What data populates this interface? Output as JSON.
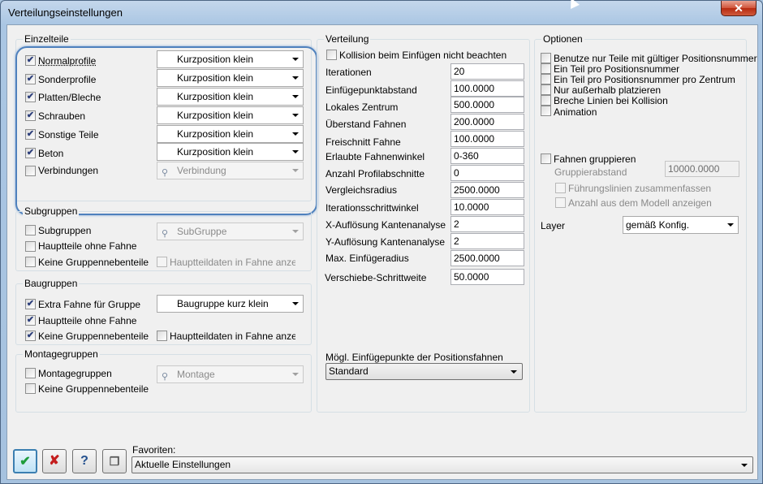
{
  "window": {
    "title": "Verteilungseinstellungen",
    "close": "✕"
  },
  "einzelteile": {
    "title": "Einzelteile",
    "rows": [
      {
        "label": "Normalprofile",
        "checked": true,
        "combo": "Kurzposition klein"
      },
      {
        "label": "Sonderprofile",
        "checked": true,
        "combo": "Kurzposition klein"
      },
      {
        "label": "Platten/Bleche",
        "checked": true,
        "combo": "Kurzposition klein"
      },
      {
        "label": "Schrauben",
        "checked": true,
        "combo": "Kurzposition klein"
      },
      {
        "label": "Sonstige Teile",
        "checked": true,
        "combo": "Kurzposition klein"
      },
      {
        "label": "Beton",
        "checked": true,
        "combo": "Kurzposition klein"
      },
      {
        "label": "Verbindungen",
        "checked": false,
        "combo": "Verbindung"
      }
    ]
  },
  "subgruppen": {
    "title": "Subgruppen",
    "subgruppen": "Subgruppen",
    "subgruppe_combo": "SubGruppe",
    "hauptteile": "Hauptteile ohne Fahne",
    "keine": "Keine Gruppennebenteile",
    "hauptteildaten": "Hauptteildaten in Fahne anzeigen"
  },
  "baugruppen": {
    "title": "Baugruppen",
    "extra": "Extra Fahne für Gruppe",
    "extra_combo": "Baugruppe kurz klein",
    "hauptteile": "Hauptteile ohne Fahne",
    "keine": "Keine Gruppennebenteile",
    "hauptteildaten": "Hauptteildaten in Fahne anzeigen"
  },
  "montagegruppen": {
    "title": "Montagegruppen",
    "montagegruppen": "Montagegruppen",
    "montage_combo": "Montage",
    "keine": "Keine Gruppennebenteile"
  },
  "verteilung": {
    "title": "Verteilung",
    "kollision": "Kollision beim Einfügen nicht beachten",
    "fields": [
      {
        "label": "Iterationen",
        "value": "20"
      },
      {
        "label": "Einfügepunktabstand",
        "value": "100.0000"
      },
      {
        "label": "Lokales Zentrum",
        "value": "500.0000"
      },
      {
        "label": "Überstand Fahnen",
        "value": "200.0000"
      },
      {
        "label": "Freischnitt Fahne",
        "value": "100.0000"
      },
      {
        "label": "Erlaubte Fahnenwinkel",
        "value": "0-360"
      },
      {
        "label": "Anzahl Profilabschnitte",
        "value": "0"
      },
      {
        "label": "Vergleichsradius",
        "value": "2500.0000"
      },
      {
        "label": "Iterationsschrittwinkel",
        "value": "10.0000"
      },
      {
        "label": "X-Auflösung Kantenanalyse",
        "value": "2"
      },
      {
        "label": "Y-Auflösung Kantenanalyse",
        "value": "2"
      },
      {
        "label": "Max. Einfügeradius",
        "value": "2500.0000"
      },
      {
        "label": "Verschiebe-Schrittweite",
        "value": "50.0000"
      }
    ],
    "einfuege_label": "Mögl. Einfügepunkte der Positionsfahnen",
    "einfuege_value": "Standard"
  },
  "optionen": {
    "title": "Optionen",
    "items": [
      "Benutze nur Teile mit gültiger Positionsnummer",
      "Ein Teil pro Positionsnummer",
      "Ein Teil pro Positionsnummer pro Zentrum",
      "Nur außerhalb platzieren",
      "Breche Linien bei Kollision",
      "Animation"
    ],
    "fahnen": "Fahnen gruppieren",
    "gruppierabstand": "Gruppierabstand",
    "gruppierabstand_value": "10000.0000",
    "fuehrungslinien": "Führungslinien zusammenfassen",
    "anzahl": "Anzahl aus dem Modell anzeigen",
    "layer": "Layer",
    "layer_value": "gemäß Konfig."
  },
  "footer": {
    "favoriten": "Favoriten:",
    "favoriten_value": "Aktuelle Einstellungen",
    "ok": "✔",
    "cancel": "✘",
    "help": "?",
    "copy": "❐"
  }
}
